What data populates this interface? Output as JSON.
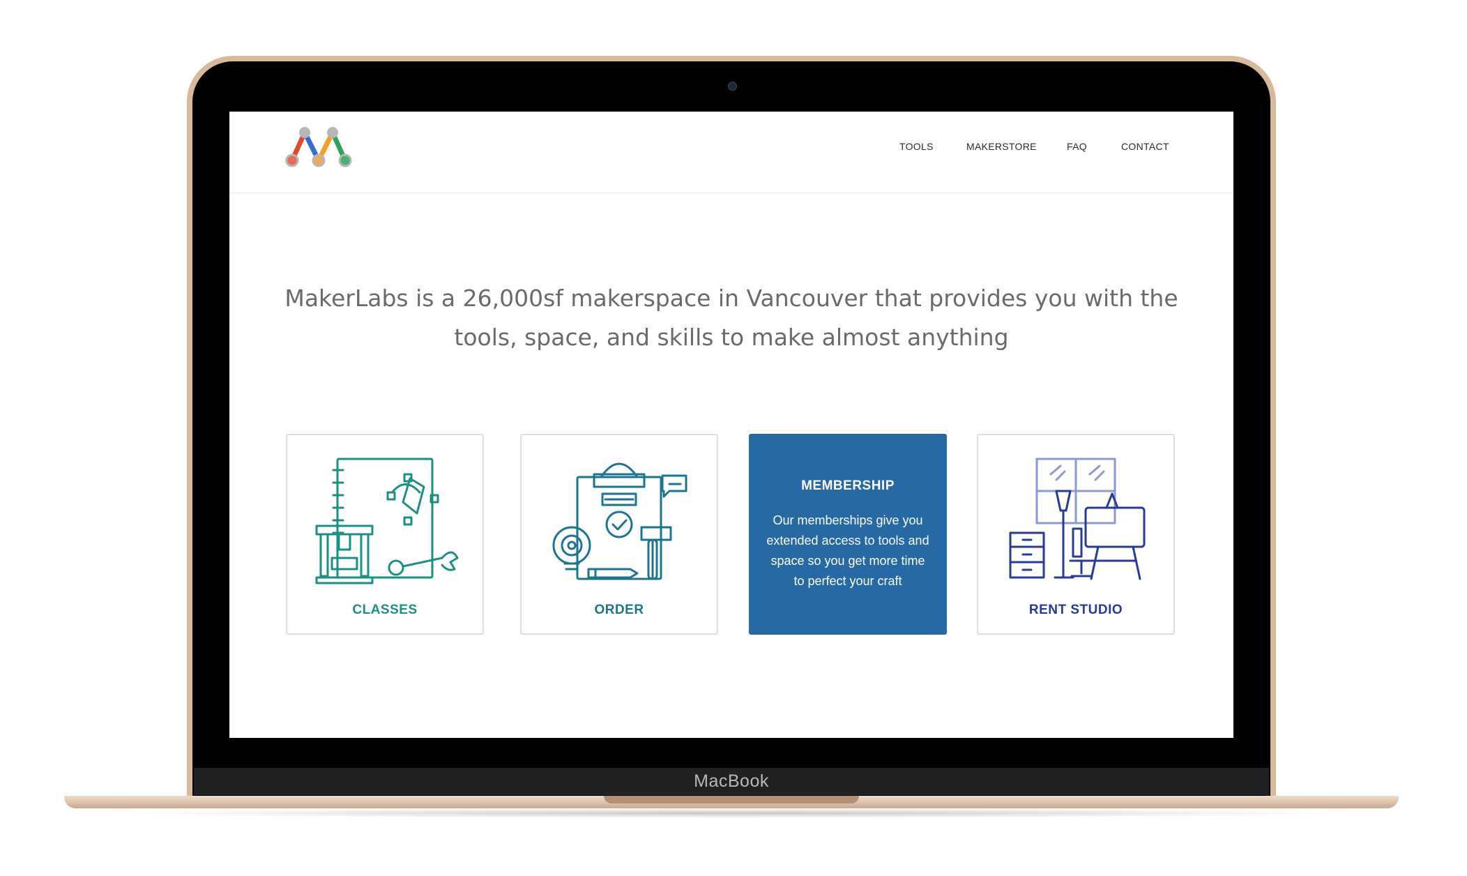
{
  "device": {
    "brand_label": "MacBook"
  },
  "header": {
    "logo_icon": "makerlabs-m-logo",
    "nav": [
      {
        "label": "TOOLS"
      },
      {
        "label": "MAKERSTORE"
      },
      {
        "label": "FAQ"
      },
      {
        "label": "CONTACT"
      }
    ]
  },
  "hero": {
    "line1": "MakerLabs is a 26,000sf makerspace in Vancouver that provides you with the",
    "line2": "tools, space, and skills to make almost anything"
  },
  "cards": {
    "classes": {
      "label": "CLASSES",
      "icon": "classes-tools-icon",
      "color": "#1a8f83"
    },
    "order": {
      "label": "ORDER",
      "icon": "order-checklist-icon",
      "color": "#1a7591"
    },
    "membership": {
      "title": "MEMBERSHIP",
      "description": "Our memberships give you extended access to tools and space so you get more time to perfect your craft",
      "color": "#2769a4"
    },
    "rent": {
      "label": "RENT STUDIO",
      "icon": "studio-room-icon",
      "color": "#27399a"
    }
  },
  "colors": {
    "lid": "#d8b99a",
    "bezel": "#000000",
    "text_gray": "#6a6a6a"
  }
}
